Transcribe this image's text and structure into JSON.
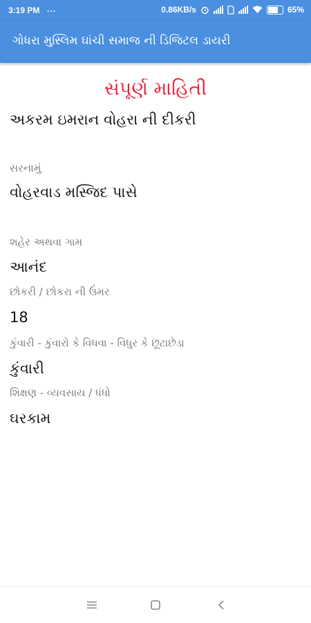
{
  "status_bar": {
    "time": "3:19 PM",
    "dots": "...",
    "network_speed": "0.86KB/s",
    "battery_percent": "65%",
    "battery_level": 0.65
  },
  "app_bar": {
    "title": "ગોધરા મુસ્લિમ ઘાંચી સમાજ ની ડિજિટલ ડાયરી"
  },
  "details": {
    "heading": "સંપૂર્ણ માહિતી",
    "name": "અકરમ ઇમરાન વોહરા ની દીકરી",
    "address_label": "સરનામું",
    "address_value": "વોહરવાડ મસ્જિદ પાસે",
    "city_label": "શહેર અથવા ગામ",
    "city_value": "આનંદ",
    "age_label": "છોકરી / છોકરા ની ઉંમર",
    "age_value": "18",
    "marital_label": "કુંવારી - કુંવારો કે વિધવા - વિધુર કે છૂટાછેડા",
    "marital_value": "કુંવારી",
    "occupation_label": "શિક્ષણ - વ્યવસાય / ધંધો",
    "occupation_value": "ઘરકામ"
  },
  "nav_bar": {
    "icons": [
      "menu-icon",
      "home-square-icon",
      "back-chevron-icon"
    ]
  }
}
